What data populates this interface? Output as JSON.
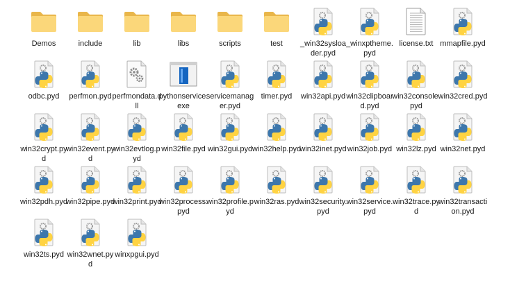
{
  "colors": {
    "folder_back": "#e9b64a",
    "folder_front": "#fbd77a",
    "python_blue": "#3d77ac",
    "python_yellow": "#ffd342",
    "page": "#f5f5f5",
    "gear": "#8a8a8a",
    "exe_blue": "#1565c0"
  },
  "files": [
    {
      "name": "Demos",
      "icon": "folder-icon"
    },
    {
      "name": "include",
      "icon": "folder-icon"
    },
    {
      "name": "lib",
      "icon": "folder-icon"
    },
    {
      "name": "libs",
      "icon": "folder-icon"
    },
    {
      "name": "scripts",
      "icon": "folder-icon"
    },
    {
      "name": "test",
      "icon": "folder-icon"
    },
    {
      "name": "_win32sysloader.pyd",
      "icon": "python-file-icon"
    },
    {
      "name": "_winxptheme.pyd",
      "icon": "python-file-icon"
    },
    {
      "name": "license.txt",
      "icon": "text-file-icon"
    },
    {
      "name": "mmapfile.pyd",
      "icon": "python-file-icon"
    },
    {
      "name": "odbc.pyd",
      "icon": "python-file-icon"
    },
    {
      "name": "perfmon.pyd",
      "icon": "python-file-icon"
    },
    {
      "name": "perfmondata.dll",
      "icon": "dll-file-icon"
    },
    {
      "name": "pythonservice.exe",
      "icon": "exe-file-icon"
    },
    {
      "name": "servicemanager.pyd",
      "icon": "python-file-icon"
    },
    {
      "name": "timer.pyd",
      "icon": "python-file-icon"
    },
    {
      "name": "win32api.pyd",
      "icon": "python-file-icon"
    },
    {
      "name": "win32clipboard.pyd",
      "icon": "python-file-icon"
    },
    {
      "name": "win32console.pyd",
      "icon": "python-file-icon"
    },
    {
      "name": "win32cred.pyd",
      "icon": "python-file-icon"
    },
    {
      "name": "win32crypt.pyd",
      "icon": "python-file-icon"
    },
    {
      "name": "win32event.pyd",
      "icon": "python-file-icon"
    },
    {
      "name": "win32evtlog.pyd",
      "icon": "python-file-icon"
    },
    {
      "name": "win32file.pyd",
      "icon": "python-file-icon"
    },
    {
      "name": "win32gui.pyd",
      "icon": "python-file-icon"
    },
    {
      "name": "win32help.pyd",
      "icon": "python-file-icon"
    },
    {
      "name": "win32inet.pyd",
      "icon": "python-file-icon"
    },
    {
      "name": "win32job.pyd",
      "icon": "python-file-icon"
    },
    {
      "name": "win32lz.pyd",
      "icon": "python-file-icon"
    },
    {
      "name": "win32net.pyd",
      "icon": "python-file-icon"
    },
    {
      "name": "win32pdh.pyd",
      "icon": "python-file-icon"
    },
    {
      "name": "win32pipe.pyd",
      "icon": "python-file-icon"
    },
    {
      "name": "win32print.pyd",
      "icon": "python-file-icon"
    },
    {
      "name": "win32process.pyd",
      "icon": "python-file-icon"
    },
    {
      "name": "win32profile.pyd",
      "icon": "python-file-icon"
    },
    {
      "name": "win32ras.pyd",
      "icon": "python-file-icon"
    },
    {
      "name": "win32security.pyd",
      "icon": "python-file-icon"
    },
    {
      "name": "win32service.pyd",
      "icon": "python-file-icon"
    },
    {
      "name": "win32trace.pyd",
      "icon": "python-file-icon"
    },
    {
      "name": "win32transaction.pyd",
      "icon": "python-file-icon"
    },
    {
      "name": "win32ts.pyd",
      "icon": "python-file-icon"
    },
    {
      "name": "win32wnet.pyd",
      "icon": "python-file-icon"
    },
    {
      "name": "winxpgui.pyd",
      "icon": "python-file-icon"
    }
  ]
}
